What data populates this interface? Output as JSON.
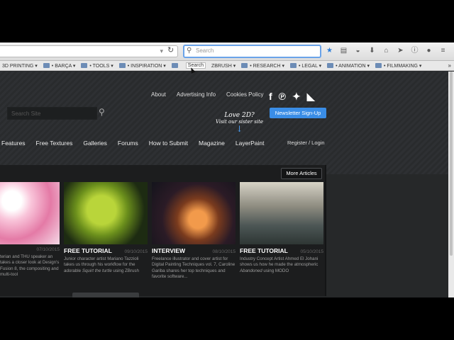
{
  "browser": {
    "search_placeholder": "Search",
    "bookmarks": [
      {
        "label": "3D PRINTING ▾"
      },
      {
        "label": "• BARÇA ▾"
      },
      {
        "label": "• TOOLS ▾"
      },
      {
        "label": "• INSPIRATION ▾"
      },
      {
        "label": "Search",
        "highlight": true
      },
      {
        "label": "ZBRUSH ▾"
      },
      {
        "label": "• RESEARCH ▾"
      },
      {
        "label": "• LEGAL ▾"
      },
      {
        "label": "• ANIMATION ▾"
      },
      {
        "label": "• FILMMAKING ▾"
      }
    ],
    "bookmarks_more": "»"
  },
  "site": {
    "top_links": [
      "About",
      "Advertising Info",
      "Cookies Policy"
    ],
    "site_search_placeholder": "Search Site",
    "newsletter": "Newsletter Sign-Up",
    "love_line1": "Love 2D?",
    "love_line2": "Visit our sister site",
    "nav": [
      "Features",
      "Free Textures",
      "Galleries",
      "Forums",
      "How to Submit",
      "Magazine",
      "LayerPaint"
    ],
    "login": "Register / Login",
    "more_articles": "More Articles"
  },
  "articles": [
    {
      "category": "",
      "date": "07/10/2015",
      "desc": "terian and THU speaker an takes a closer look at Design's Fusion 8, the compositing and multi-tool",
      "thumb_class": "t0"
    },
    {
      "category": "FREE TUTORIAL",
      "date": "09/10/2015",
      "desc_parts": [
        "Junior character artist Mariano Tazzioli takes us through his workflow for the adorable ",
        "Squirt the turtle",
        " using ZBrush"
      ],
      "thumb_class": "t1"
    },
    {
      "category": "INTERVIEW",
      "date": "08/10/2015",
      "desc": "Freelance illustrator and cover artist for Digital Painting Techniques vol. 7, Caroline Gariba shares her top techniques and favorite software...",
      "thumb_class": "t2"
    },
    {
      "category": "FREE TUTORIAL",
      "date": "05/10/2015",
      "desc_parts": [
        "Industry Concept Artist Ahmed El Johani shows us how he made the atmospheric ",
        "Abandoned",
        " using MODO"
      ],
      "thumb_class": "t3"
    }
  ],
  "colors": {
    "accent_blue": "#3a8de6",
    "page_bg": "#262829"
  }
}
